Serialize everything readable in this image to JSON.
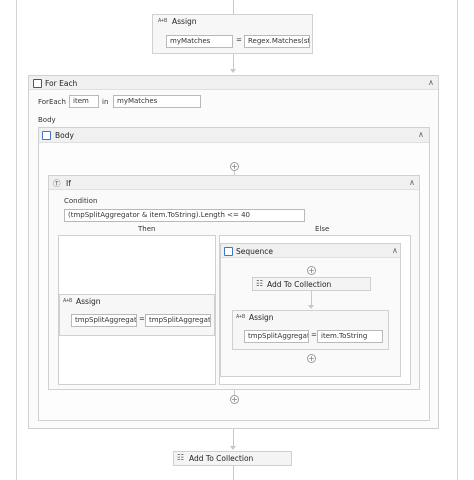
{
  "assign_top": {
    "title": "Assign",
    "icon": "A+B",
    "to": "myMatches",
    "value": "Regex.Matches(str"
  },
  "foreach": {
    "title": "For Each",
    "label": "ForEach",
    "item": "item",
    "in_label": "in",
    "collection": "myMatches",
    "body_label": "Body"
  },
  "body_seq": {
    "title": "Body"
  },
  "if_act": {
    "title": "If",
    "condition_label": "Condition",
    "condition": "(tmpSplitAggregator & item.ToString).Length <= 40",
    "then_label": "Then",
    "else_label": "Else"
  },
  "then_assign": {
    "title": "Assign",
    "icon": "A+B",
    "to": "tmpSplitAggregatc",
    "value": "tmpSplitAggregatc"
  },
  "else_seq": {
    "title": "Sequence"
  },
  "add_collection_inner": {
    "title": "Add To Collection"
  },
  "else_assign": {
    "title": "Assign",
    "icon": "A+B",
    "to": "tmpSplitAggregatc",
    "value": "item.ToString"
  },
  "add_collection_bottom": {
    "title": "Add To Collection"
  },
  "equals_sign": "=",
  "colors": {
    "border": "#d0d0d0",
    "header": "#f0f0f0",
    "accent": "#3a7bbf"
  }
}
